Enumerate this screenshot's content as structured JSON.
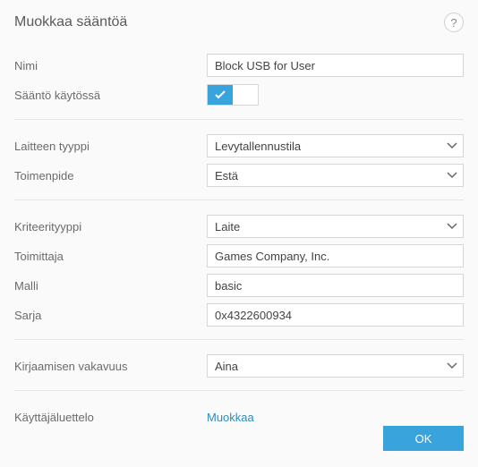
{
  "header": {
    "title": "Muokkaa sääntöä",
    "help_tooltip": "?"
  },
  "fields": {
    "name": {
      "label": "Nimi",
      "value": "Block USB for User"
    },
    "enabled": {
      "label": "Sääntö käytössä",
      "value": true
    },
    "device_type": {
      "label": "Laitteen tyyppi",
      "value": "Levytallennustila"
    },
    "action": {
      "label": "Toimenpide",
      "value": "Estä"
    },
    "criteria_type": {
      "label": "Kriteerityyppi",
      "value": "Laite"
    },
    "vendor": {
      "label": "Toimittaja",
      "value": "Games Company, Inc."
    },
    "model": {
      "label": "Malli",
      "value": "basic"
    },
    "serial": {
      "label": "Sarja",
      "value": "0x4322600934"
    },
    "logging_severity": {
      "label": "Kirjaamisen vakavuus",
      "value": "Aina"
    },
    "user_list": {
      "label": "Käyttäjäluettelo",
      "action": "Muokkaa"
    }
  },
  "footer": {
    "ok": "OK"
  }
}
